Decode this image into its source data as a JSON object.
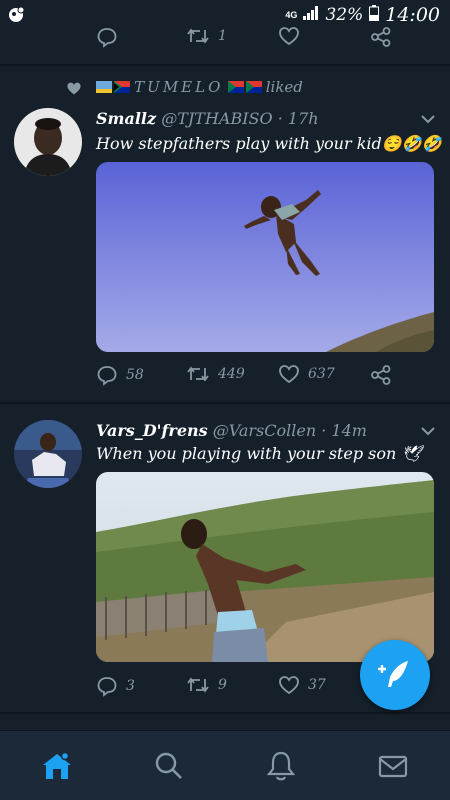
{
  "status_bar": {
    "network": "4G",
    "battery": "32%",
    "time": "14:00"
  },
  "top_partial_tweet": {
    "retweet_count": "1"
  },
  "liked_tweet": {
    "liked_by": "TUMELO",
    "liked_suffix": "liked",
    "author_name": "Smallz",
    "author_handle": "@TJTHABISO",
    "time": "17h",
    "text": "How stepfathers play with your kid",
    "emoji": "😌🤣🤣",
    "reply_count": "58",
    "retweet_count": "449",
    "like_count": "637"
  },
  "second_tweet": {
    "author_name": "Vars_D'frens",
    "author_handle": "@VarsCollen",
    "time": "14m",
    "text": "When you playing with your step son",
    "emoji": "🕊",
    "reply_count": "3",
    "retweet_count": "9",
    "like_count": "37"
  },
  "icons": {
    "reply": "reply-icon",
    "retweet": "retweet-icon",
    "like": "heart-icon",
    "share": "share-icon",
    "compose": "compose-icon",
    "home": "home-icon",
    "search": "search-icon",
    "notifications": "bell-icon",
    "messages": "mail-icon"
  },
  "colors": {
    "background": "#15202b",
    "secondary_text": "#8899a6",
    "accent": "#1da1f2",
    "nav_background": "#1c2938"
  }
}
